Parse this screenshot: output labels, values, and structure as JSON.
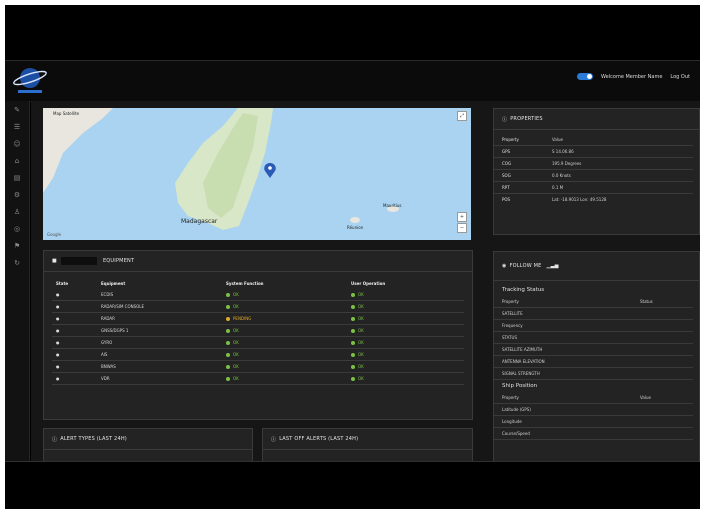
{
  "header": {
    "app_name": "",
    "user_label": "Welcome  Member Name",
    "logout_label": "Log Out"
  },
  "sidebar": {
    "items": [
      {
        "icon": "pencil-icon"
      },
      {
        "icon": "list-icon"
      },
      {
        "icon": "users-icon"
      },
      {
        "icon": "lock-icon"
      },
      {
        "icon": "chart-icon"
      },
      {
        "icon": "gear-icon"
      },
      {
        "icon": "user-icon"
      },
      {
        "icon": "globe-icon"
      },
      {
        "icon": "flag-icon"
      },
      {
        "icon": "refresh-icon"
      }
    ]
  },
  "map": {
    "type_label": "Map  Satellite",
    "country_label": "Madagascar",
    "place_labels": [
      "Mauritius",
      "Réunion"
    ],
    "attribution": "Google"
  },
  "properties": {
    "title": "PROPERTIES",
    "col_property": "Property",
    "col_value": "Value",
    "rows": [
      {
        "k": "GPS",
        "v": "S 14.06.86"
      },
      {
        "k": "COG",
        "v": "195.9 Degrees"
      },
      {
        "k": "SOG",
        "v": "0.0 Knots"
      },
      {
        "k": "RPT",
        "v": "0.1 M"
      },
      {
        "k": "POS",
        "v": "Lat: -18.9013 Lon: 49.5128"
      }
    ]
  },
  "equipment": {
    "title": "EQUIPMENT",
    "headers": [
      "State",
      "Equipment",
      "System Function",
      "User Operation"
    ],
    "rows": [
      {
        "state": "●",
        "name": "ECDIS",
        "sys": "OK",
        "sys_color": "#7cc043",
        "user": "OK",
        "user_color": "#7cc043"
      },
      {
        "state": "●",
        "name": "RADAR/SIM CONSOLE",
        "sys": "OK",
        "sys_color": "#7cc043",
        "user": "OK",
        "user_color": "#7cc043"
      },
      {
        "state": "●",
        "name": "RADAR",
        "sys": "PENDING",
        "sys_color": "#e0a82e",
        "user": "OK",
        "user_color": "#7cc043"
      },
      {
        "state": "●",
        "name": "GNSS/DGPS 1",
        "sys": "OK",
        "sys_color": "#7cc043",
        "user": "OK",
        "user_color": "#7cc043"
      },
      {
        "state": "●",
        "name": "GYRO",
        "sys": "OK",
        "sys_color": "#7cc043",
        "user": "OK",
        "user_color": "#7cc043"
      },
      {
        "state": "●",
        "name": "AIS",
        "sys": "OK",
        "sys_color": "#7cc043",
        "user": "OK",
        "user_color": "#7cc043"
      },
      {
        "state": "●",
        "name": "BNWAS",
        "sys": "OK",
        "sys_color": "#7cc043",
        "user": "OK",
        "user_color": "#7cc043"
      },
      {
        "state": "●",
        "name": "VDR",
        "sys": "OK",
        "sys_color": "#7cc043",
        "user": "OK",
        "user_color": "#7cc043"
      }
    ]
  },
  "alerts": {
    "alert_types_title": "ALERT TYPES (LAST 24H)",
    "last_alerts_title": "LAST OFF ALERTS (LAST 24H)"
  },
  "follow": {
    "title": "FOLLOW ME",
    "tracking_title": "Tracking Status",
    "col_property": "Property",
    "col_value": "Status",
    "tracking_rows": [
      "SATELLITE",
      "Frequency",
      "STATUS",
      "SATELLITE AZIMUTH",
      "ANTENNA ELEVATION",
      "SIGNAL STRENGTH"
    ],
    "ship_title": "Ship Position",
    "ship_col_property": "Property",
    "ship_col_value": "Value",
    "ship_rows": [
      "Latitude (GPS)",
      "Longitude",
      "Course/Speed"
    ]
  }
}
